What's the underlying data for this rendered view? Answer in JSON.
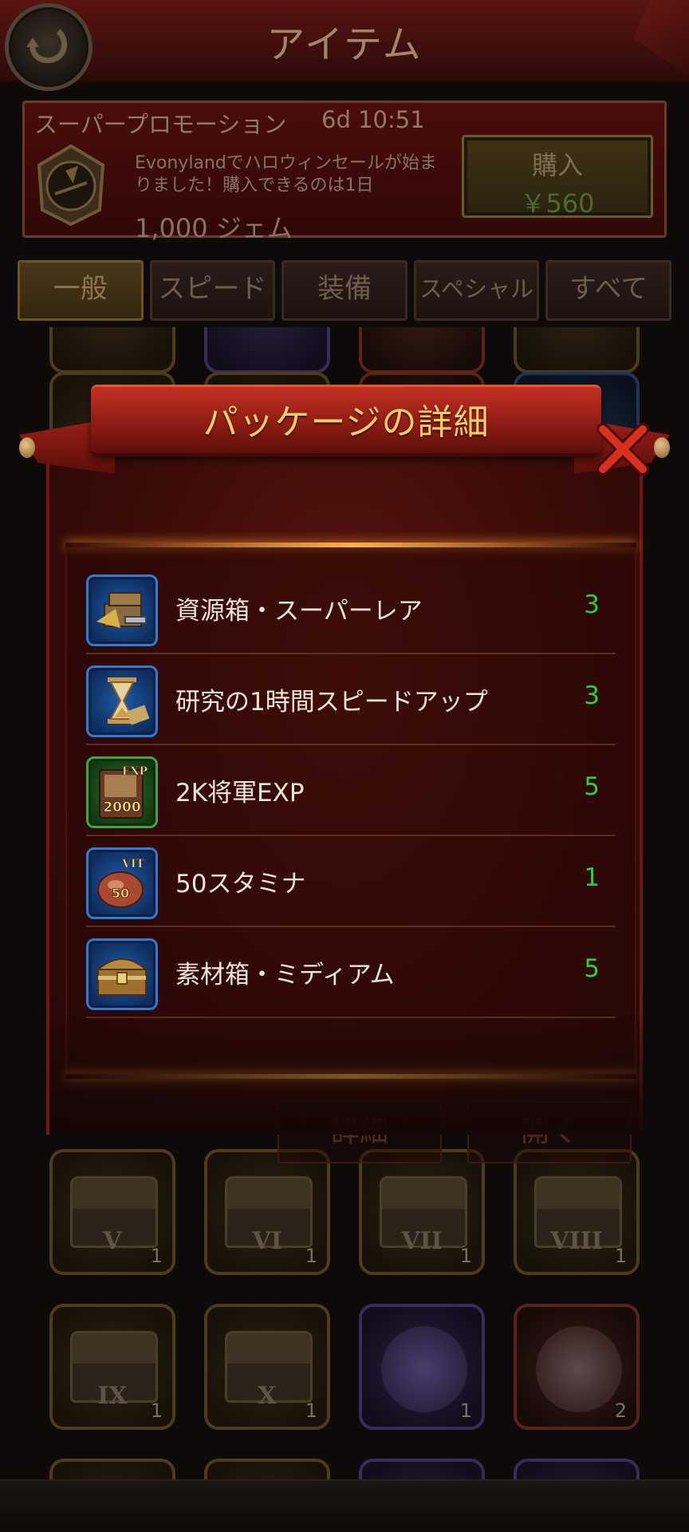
{
  "header": {
    "title": "アイテム"
  },
  "promo": {
    "title": "スーパープロモーション",
    "timer": "6d 10:51",
    "description": "Evonylandでハロウィンセールが始まりました！購入できるのは1日",
    "gems": "1,000 ジェム",
    "buy_label": "購入",
    "buy_price": "￥560"
  },
  "tabs": [
    {
      "label": "一般",
      "active": true
    },
    {
      "label": "スピード"
    },
    {
      "label": "装備"
    },
    {
      "label": "スペシャル"
    },
    {
      "label": "すべて"
    }
  ],
  "grid": {
    "row1": [
      {
        "numeral": "V",
        "count": "1"
      },
      {
        "numeral": "VI",
        "count": "1"
      },
      {
        "numeral": "VII",
        "count": "1"
      },
      {
        "numeral": "VIII",
        "count": "1"
      }
    ],
    "row2": [
      {
        "numeral": "IX",
        "count": "1"
      },
      {
        "numeral": "X",
        "count": "1"
      },
      {
        "numeral": "",
        "count": "1"
      },
      {
        "numeral": "",
        "count": "2"
      }
    ]
  },
  "dialog": {
    "title": "パッケージの詳細",
    "items": [
      {
        "name": "資源箱・スーパーレア",
        "qty": "3",
        "icon": "resource-crate-icon"
      },
      {
        "name": "研究の1時間スピードアップ",
        "qty": "3",
        "icon": "hourglass-icon"
      },
      {
        "name": "2K将軍EXP",
        "qty": "5",
        "icon": "exp-book-icon",
        "badge_top": "EXP",
        "badge_num": "2000"
      },
      {
        "name": "50スタミナ",
        "qty": "1",
        "icon": "stamina-meat-icon",
        "badge_top": "VIT",
        "badge_num": "50"
      },
      {
        "name": "素材箱・ミディアム",
        "qty": "5",
        "icon": "material-chest-icon"
      }
    ],
    "details_button": "詳細",
    "open_button": "開く"
  },
  "colors": {
    "qty_green": "#2fd12a",
    "title_gold": "#f7cf6a",
    "dialog_red": "#8a1b14"
  }
}
